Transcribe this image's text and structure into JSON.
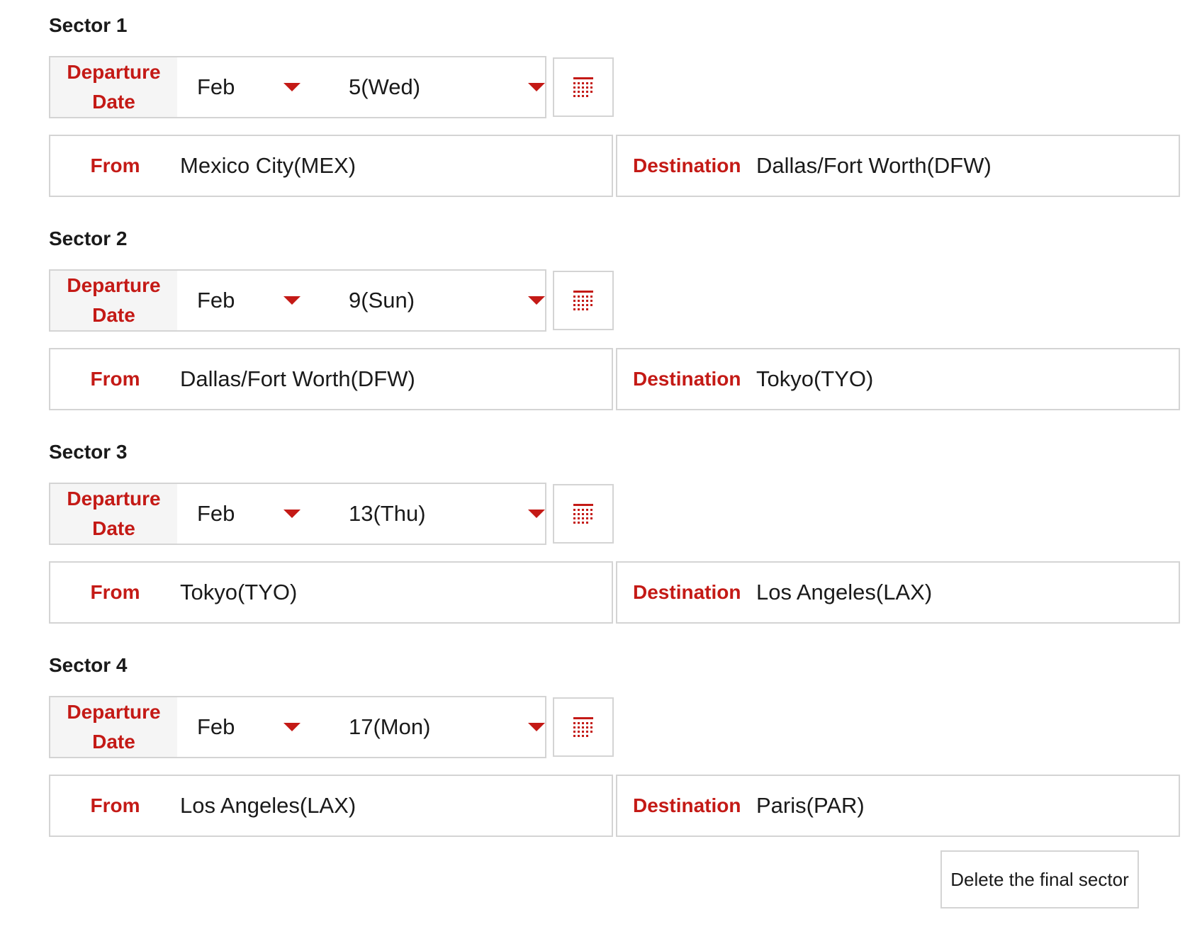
{
  "sectors": [
    {
      "title": "Sector 1",
      "date_label": "Departure Date",
      "month": "Feb",
      "day": "5(Wed)",
      "from_label": "From",
      "from": "Mexico City(MEX)",
      "dest_label": "Destination",
      "destination": "Dallas/Fort Worth(DFW)"
    },
    {
      "title": "Sector 2",
      "date_label": "Departure Date",
      "month": "Feb",
      "day": "9(Sun)",
      "from_label": "From",
      "from": "Dallas/Fort Worth(DFW)",
      "dest_label": "Destination",
      "destination": "Tokyo(TYO)"
    },
    {
      "title": "Sector 3",
      "date_label": "Departure Date",
      "month": "Feb",
      "day": "13(Thu)",
      "from_label": "From",
      "from": "Tokyo(TYO)",
      "dest_label": "Destination",
      "destination": "Los Angeles(LAX)"
    },
    {
      "title": "Sector 4",
      "date_label": "Departure Date",
      "month": "Feb",
      "day": "17(Mon)",
      "from_label": "From",
      "from": "Los Angeles(LAX)",
      "dest_label": "Destination",
      "destination": "Paris(PAR)"
    }
  ],
  "delete_button": "Delete the final sector",
  "icons": {
    "calendar": "calendar-icon",
    "caret": "caret-down-icon"
  },
  "colors": {
    "accent": "#c41a16",
    "border": "#d4d4d4",
    "label_bg": "#f5f5f5"
  }
}
